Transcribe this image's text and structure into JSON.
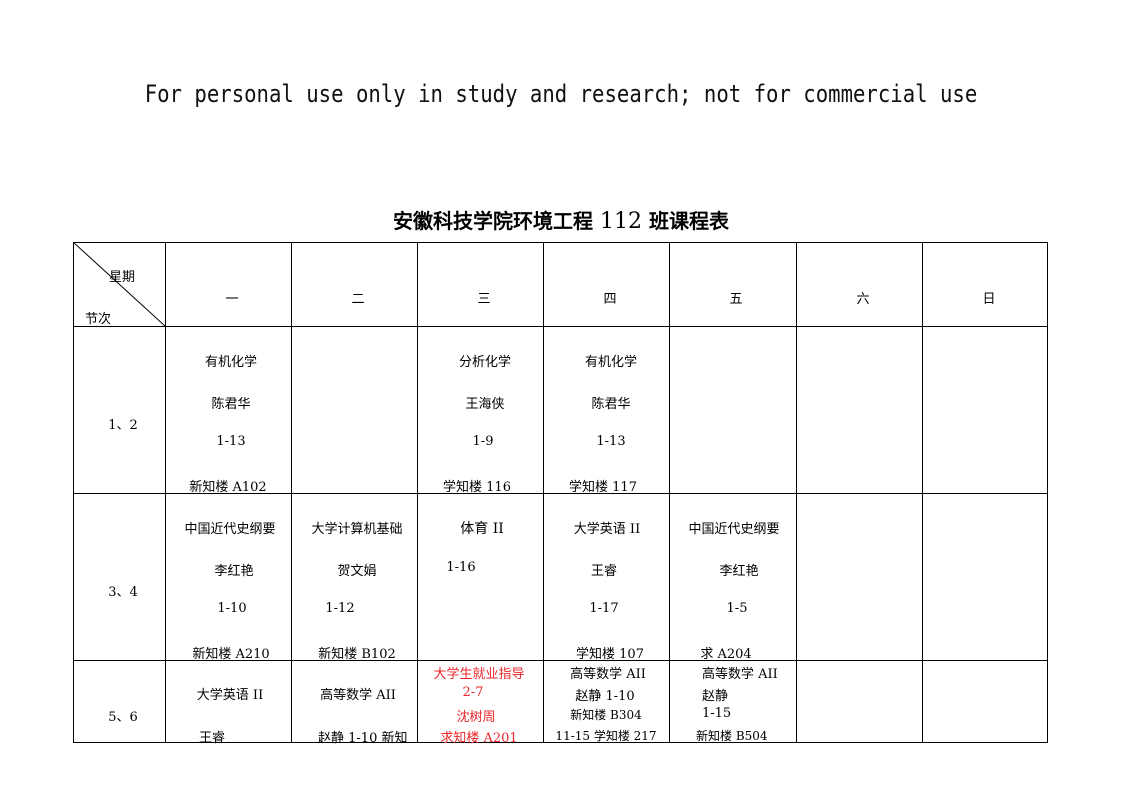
{
  "watermark": "For personal use only in study and research; not for commercial use",
  "title": {
    "prefix": "安徽科技学院环境工程",
    "class_number": "112",
    "suffix": "班课程表"
  },
  "table": {
    "corner": {
      "top_right": "星期",
      "bottom_left": "节次"
    },
    "days": [
      "一",
      "二",
      "三",
      "四",
      "五",
      "六",
      "日"
    ],
    "rows": [
      {
        "period": "1、2",
        "cells": [
          {
            "course": "有机化学",
            "teacher": "陈君华",
            "weeks": "1-13",
            "room": "新知楼 A102"
          },
          null,
          {
            "course": "分析化学",
            "teacher": "王海侠",
            "weeks": "1-9",
            "room": "学知楼 116"
          },
          {
            "course": "有机化学",
            "teacher": "陈君华",
            "weeks": "1-13",
            "room": "学知楼 117"
          },
          null,
          null,
          null
        ]
      },
      {
        "period": "3、4",
        "cells": [
          {
            "course": "中国近代史纲要",
            "teacher": "李红艳",
            "weeks": "1-10",
            "room": "新知楼 A210"
          },
          {
            "course": "大学计算机基础",
            "teacher": "贺文娟",
            "weeks": "1-12",
            "room": "新知楼 B102"
          },
          {
            "course": "体育 II",
            "weeks": "1-16"
          },
          {
            "course": "大学英语 II",
            "teacher": "王睿",
            "weeks": "1-17",
            "room": "学知楼 107"
          },
          {
            "course": "中国近代史纲要",
            "teacher": "李红艳",
            "weeks": "1-5",
            "room": "求 A204"
          },
          null,
          null
        ]
      },
      {
        "period": "5、6",
        "cells": [
          {
            "lines": [
              "大学英语 II",
              "王睿"
            ]
          },
          {
            "lines": [
              "高等数学 AII",
              "赵静 1-10 新知"
            ]
          },
          {
            "lines": [
              "大学生就业指导",
              "2-7",
              "沈树周",
              "求知楼 A201"
            ],
            "highlight_color": "#e8262a"
          },
          {
            "lines": [
              "高等数学 AII",
              "赵静 1-10",
              "新知楼 B304",
              "11-15 学知楼 217"
            ]
          },
          {
            "lines": [
              "高等数学 AII",
              "赵静",
              "1-15",
              "新知楼 B504"
            ]
          },
          null,
          null
        ]
      }
    ]
  }
}
